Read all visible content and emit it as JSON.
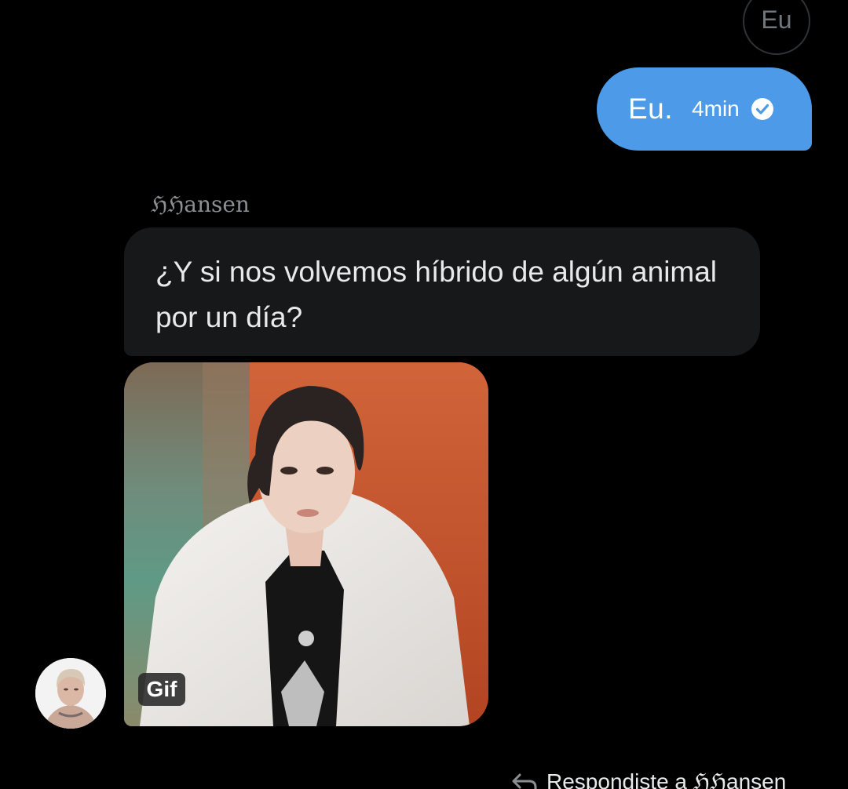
{
  "quoted": {
    "label": "Eu"
  },
  "sent_message": {
    "text": "Eu.",
    "time": "4min",
    "status_icon": "check-circle-icon",
    "bubble_color": "#4c9ae8"
  },
  "received_message": {
    "sender": "ℌℌansen",
    "text": "¿Y si nos volvemos híbrido de algún animal por un día?",
    "bubble_color": "#17181a",
    "media_badge": "Gif",
    "avatar_icon": "user-avatar"
  },
  "reply_indicator": {
    "icon": "reply-arrow-icon",
    "text": "Respondiste a ℌℌansen"
  }
}
